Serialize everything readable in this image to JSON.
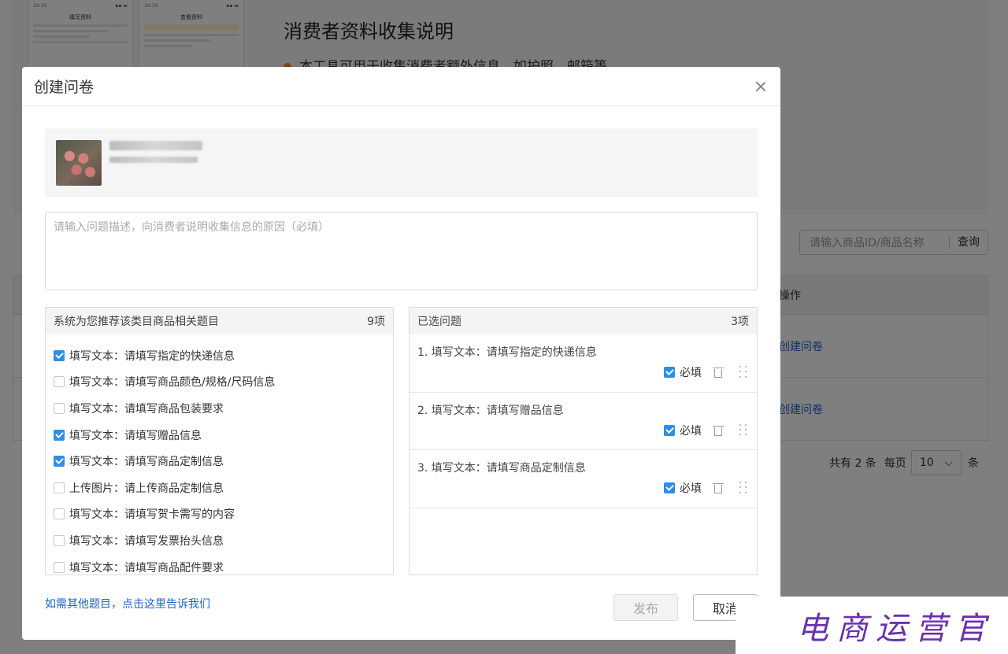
{
  "background": {
    "title": "消费者资料收集说明",
    "bullet": "本工具可用于收集消费者额外信息，如护照、邮箱等",
    "phones": [
      {
        "time": "10:10",
        "title": "填写资料"
      },
      {
        "time": "10:10",
        "title": "查看资料"
      }
    ],
    "search_placeholder": "请输入商品ID/商品名称",
    "search_button": "查询",
    "table_header_action": "操作",
    "rows": [
      {
        "action": "创建问卷"
      },
      {
        "action": "创建问卷"
      }
    ],
    "pager": {
      "total": "共有 2 条",
      "per_page_label": "每页",
      "per_page_value": "10",
      "unit": "条"
    }
  },
  "modal": {
    "title": "创建问卷",
    "description_placeholder": "请输入问题描述，向消费者说明收集信息的原因（必填）",
    "recommend": {
      "title": "系统为您推荐该类目商品相关题目",
      "count": "9项",
      "items": [
        {
          "label": "填写文本：请填写指定的快递信息",
          "checked": true
        },
        {
          "label": "填写文本：请填写商品颜色/规格/尺码信息",
          "checked": false
        },
        {
          "label": "填写文本：请填写商品包装要求",
          "checked": false
        },
        {
          "label": "填写文本：请填写赠品信息",
          "checked": true
        },
        {
          "label": "填写文本：请填写商品定制信息",
          "checked": true
        },
        {
          "label": "上传图片：请上传商品定制信息",
          "checked": false
        },
        {
          "label": "填写文本：请填写贺卡需写的内容",
          "checked": false
        },
        {
          "label": "填写文本：请填写发票抬头信息",
          "checked": false
        },
        {
          "label": "填写文本：请填写商品配件要求",
          "checked": false
        }
      ]
    },
    "selected": {
      "title": "已选问题",
      "count": "3项",
      "required_label": "必填",
      "items": [
        {
          "label": "1. 填写文本：请填写指定的快递信息",
          "required": true
        },
        {
          "label": "2. 填写文本：请填写赠品信息",
          "required": true
        },
        {
          "label": "3. 填写文本：请填写商品定制信息",
          "required": true
        }
      ]
    },
    "footer_link": "如需其他题目，点击这里告诉我们",
    "publish_label": "发布",
    "cancel_label": "取消"
  },
  "watermark": {
    "text": "电商运营官"
  },
  "colors": {
    "accent": "#2d8ee8",
    "link": "#1e64c8",
    "watermark": "#6b2fb0"
  }
}
